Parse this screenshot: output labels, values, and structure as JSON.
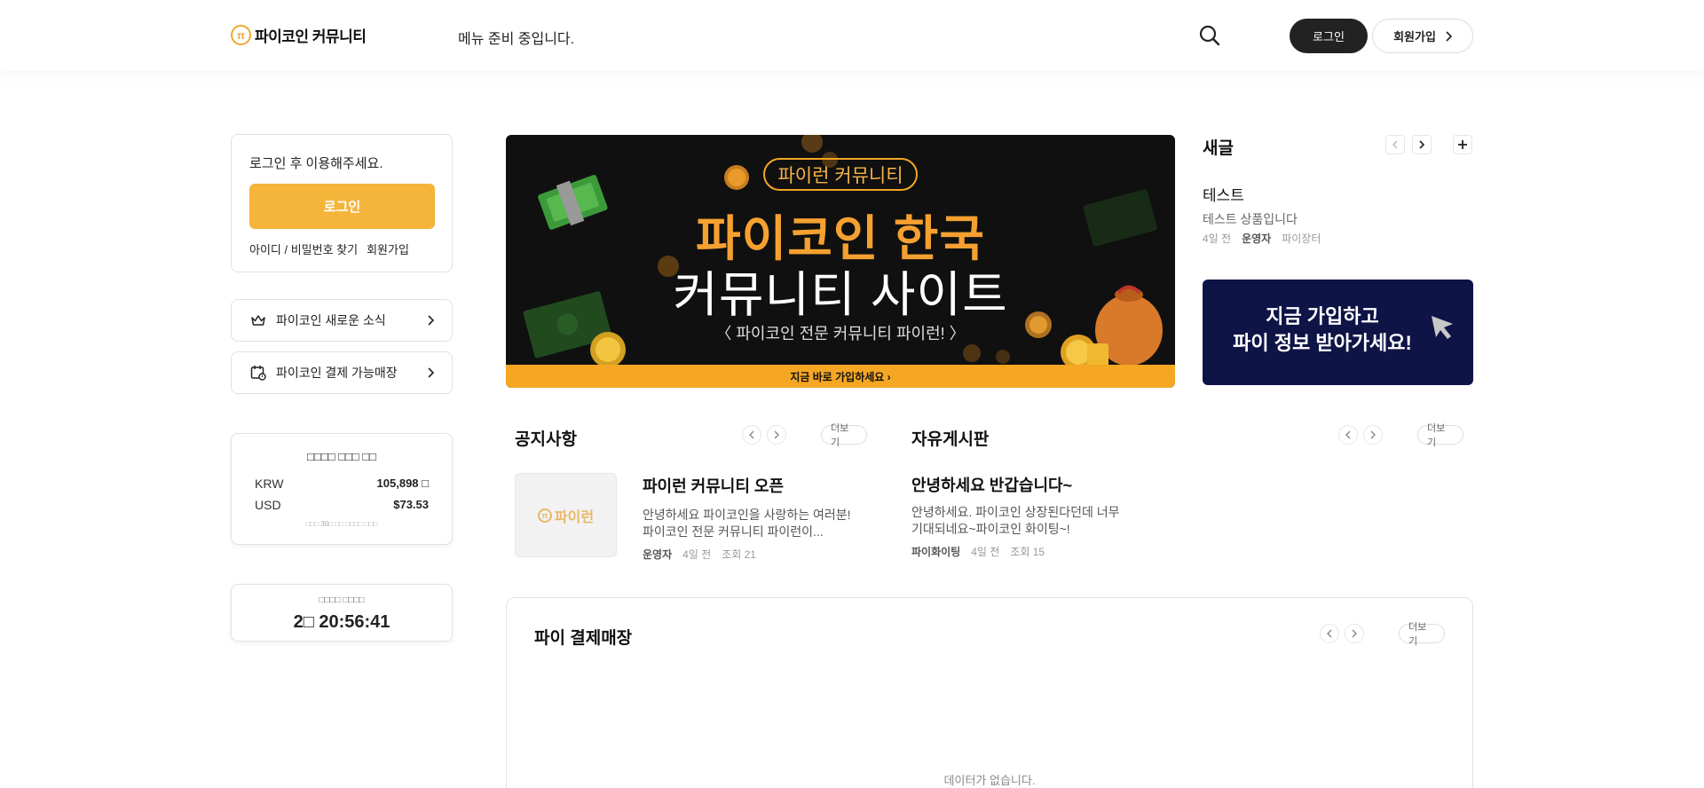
{
  "header": {
    "logo_text": "파이코인 커뮤니티",
    "logo_mark": "π",
    "menu_message": "메뉴 준비 중입니다.",
    "login_label": "로그인",
    "join_label": "회원가입"
  },
  "sidebar": {
    "login_message": "로그인 후 이용해주세요.",
    "login_button": "로그인",
    "find_account": "아이디 / 비밀번호 찾기",
    "join": "회원가입",
    "links": [
      {
        "label": "파이코인 새로운 소식",
        "icon": "crown-icon"
      },
      {
        "label": "파이코인 결제 가능매장",
        "icon": "calendar-icon"
      }
    ],
    "price": {
      "title": "□□□□ □□□ □□",
      "rows": [
        {
          "currency": "KRW",
          "value": "105,898 □"
        },
        {
          "currency": "USD",
          "value": "$73.53"
        }
      ],
      "note": "□□□ 30□ □□ □□□□ □□□"
    },
    "timer": {
      "label": "□□□□ □□□□",
      "value": "2□ 20:56:41"
    }
  },
  "banner": {
    "pill": "파이런 커뮤니티",
    "title1": "파이코인 한국",
    "title2": "커뮤니티 사이트",
    "subtitle": "〈 파이코인 전문 커뮤니티 파이런! 〉",
    "cta": "지금 바로 가입하세요 ›"
  },
  "new_posts": {
    "title": "새글",
    "item": {
      "title": "테스트",
      "desc": "테스트 상품입니다",
      "time": "4일 전",
      "author": "운영자",
      "board": "파이장터"
    },
    "ad_text_line1": "지금 가입하고",
    "ad_text_line2": "파이 정보 받아가세요!"
  },
  "notice": {
    "title": "공지사항",
    "more": "더보기",
    "thumb_text": "파이런",
    "post": {
      "title": "파이런 커뮤니티 오픈",
      "body_line1": "안녕하세요 파이코인을 사랑하는 여러분!",
      "body_line2": "파이코인 전문 커뮤니티 파이런이...",
      "author": "운영자",
      "time": "4일 전",
      "views": "조회 21"
    }
  },
  "free_board": {
    "title": "자유게시판",
    "more": "더보기",
    "post": {
      "title": "안녕하세요 반갑습니다~",
      "body_line1": "안녕하세요. 파이코인 상장된다던데 너무",
      "body_line2": "기대되네요~파이코인 화이팅~!",
      "author": "파이화이팅",
      "time": "4일 전",
      "views": "조회 15"
    }
  },
  "store": {
    "title": "파이 결제매장",
    "more": "더보기",
    "empty": "데이터가 없습니다."
  },
  "colors": {
    "accent": "#f5b43a",
    "dark": "#222222",
    "ad_bg": "#0f1446"
  }
}
